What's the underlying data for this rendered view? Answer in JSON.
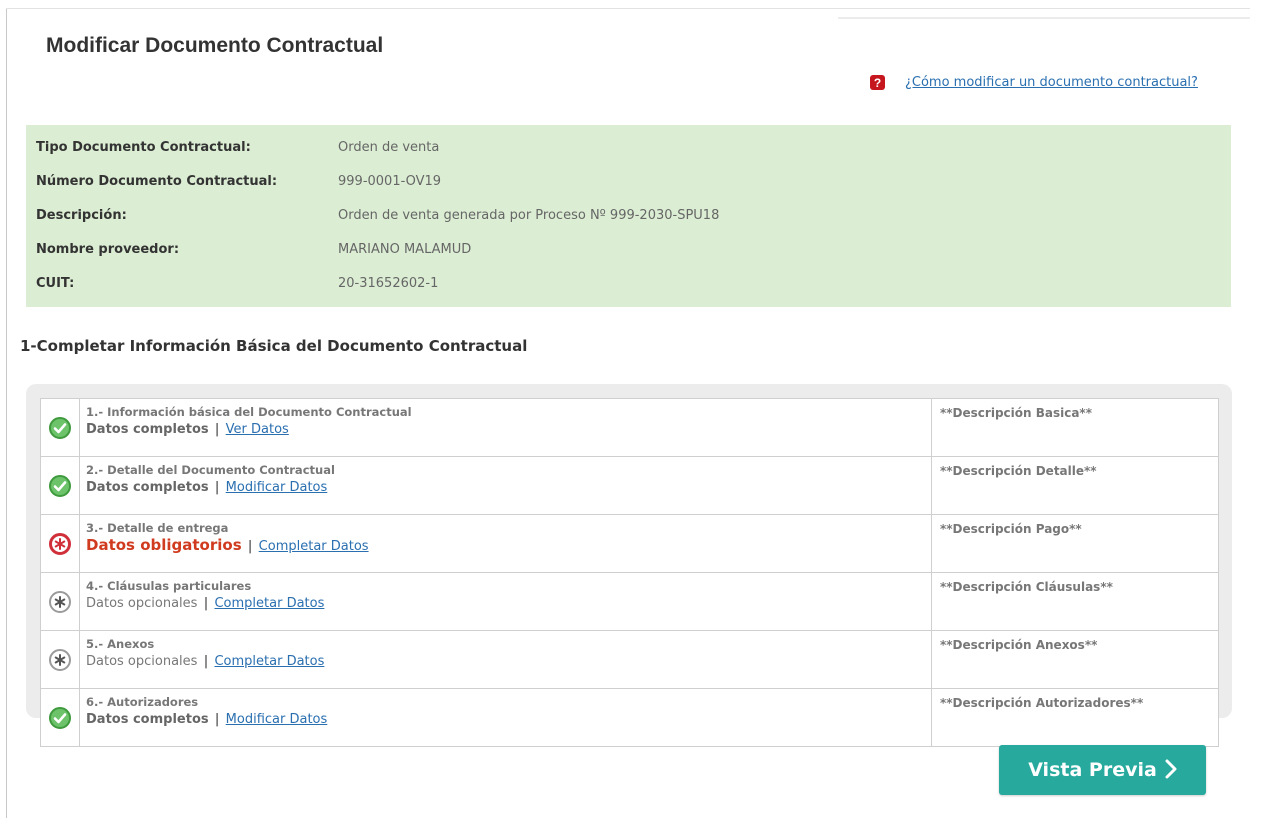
{
  "page_title": "Modificar Documento Contractual",
  "help": {
    "icon": "question-icon",
    "glyph": "?",
    "link_text": "¿Cómo modificar un documento contractual?"
  },
  "info": [
    {
      "label": "Tipo Documento Contractual:",
      "value": "Orden de venta"
    },
    {
      "label": "Número Documento Contractual:",
      "value": "999-0001-OV19"
    },
    {
      "label": "Descripción:",
      "value": "Orden de venta generada por Proceso Nº 999-2030-SPU18"
    },
    {
      "label": "Nombre proveedor:",
      "value": "MARIANO MALAMUD"
    },
    {
      "label": "CUIT:",
      "value": "20-31652602-1"
    }
  ],
  "section_title": "1-Completar Información Básica del Documento Contractual",
  "steps": [
    {
      "status": "complete",
      "title": "1.- Información básica del Documento Contractual",
      "status_text": "Datos completos",
      "link": "Ver Datos",
      "description": "**Descripción Basica**"
    },
    {
      "status": "complete",
      "title": "2.- Detalle del Documento Contractual",
      "status_text": "Datos completos",
      "link": "Modificar Datos",
      "description": "**Descripción Detalle**"
    },
    {
      "status": "required",
      "title": "3.- Detalle de entrega",
      "status_text": "Datos obligatorios",
      "link": "Completar Datos",
      "description": "**Descripción Pago**"
    },
    {
      "status": "optional",
      "title": "4.- Cláusulas particulares",
      "status_text": "Datos opcionales",
      "link": "Completar Datos",
      "description": "**Descripción Cláusulas**"
    },
    {
      "status": "optional",
      "title": "5.- Anexos",
      "status_text": "Datos opcionales",
      "link": "Completar Datos",
      "description": "**Descripción Anexos**"
    },
    {
      "status": "complete",
      "title": "6.- Autorizadores",
      "status_text": "Datos completos",
      "link": "Modificar Datos",
      "description": "**Descripción Autorizadores**"
    }
  ],
  "separator": "|",
  "preview_button": {
    "label": "Vista Previa",
    "icon": "chevron-right-icon"
  },
  "colors": {
    "info_bg": "#dbedd3",
    "button": "#27a99e",
    "link": "#2a6fb0",
    "required": "#d03a1e",
    "ok": "#6cc36a"
  }
}
